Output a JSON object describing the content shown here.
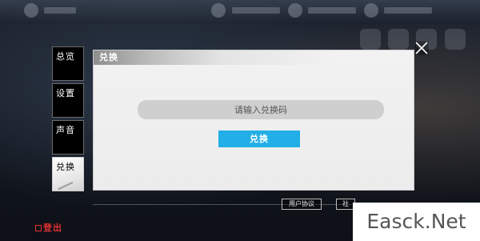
{
  "sidebar": {
    "items": [
      {
        "label": "总览",
        "active": false
      },
      {
        "label": "设置",
        "active": false
      },
      {
        "label": "声音",
        "active": false
      },
      {
        "label": "兑换",
        "active": true
      }
    ]
  },
  "dialog": {
    "title": "兑换",
    "input_placeholder": "请输入兑换码",
    "submit_label": "兑换"
  },
  "footer": {
    "user_agreement": "用户协议",
    "other_partial": "社",
    "logout": "登出"
  },
  "watermark": "Easck.Net",
  "colors": {
    "accent": "#22aee6",
    "logout": "#e23131"
  }
}
